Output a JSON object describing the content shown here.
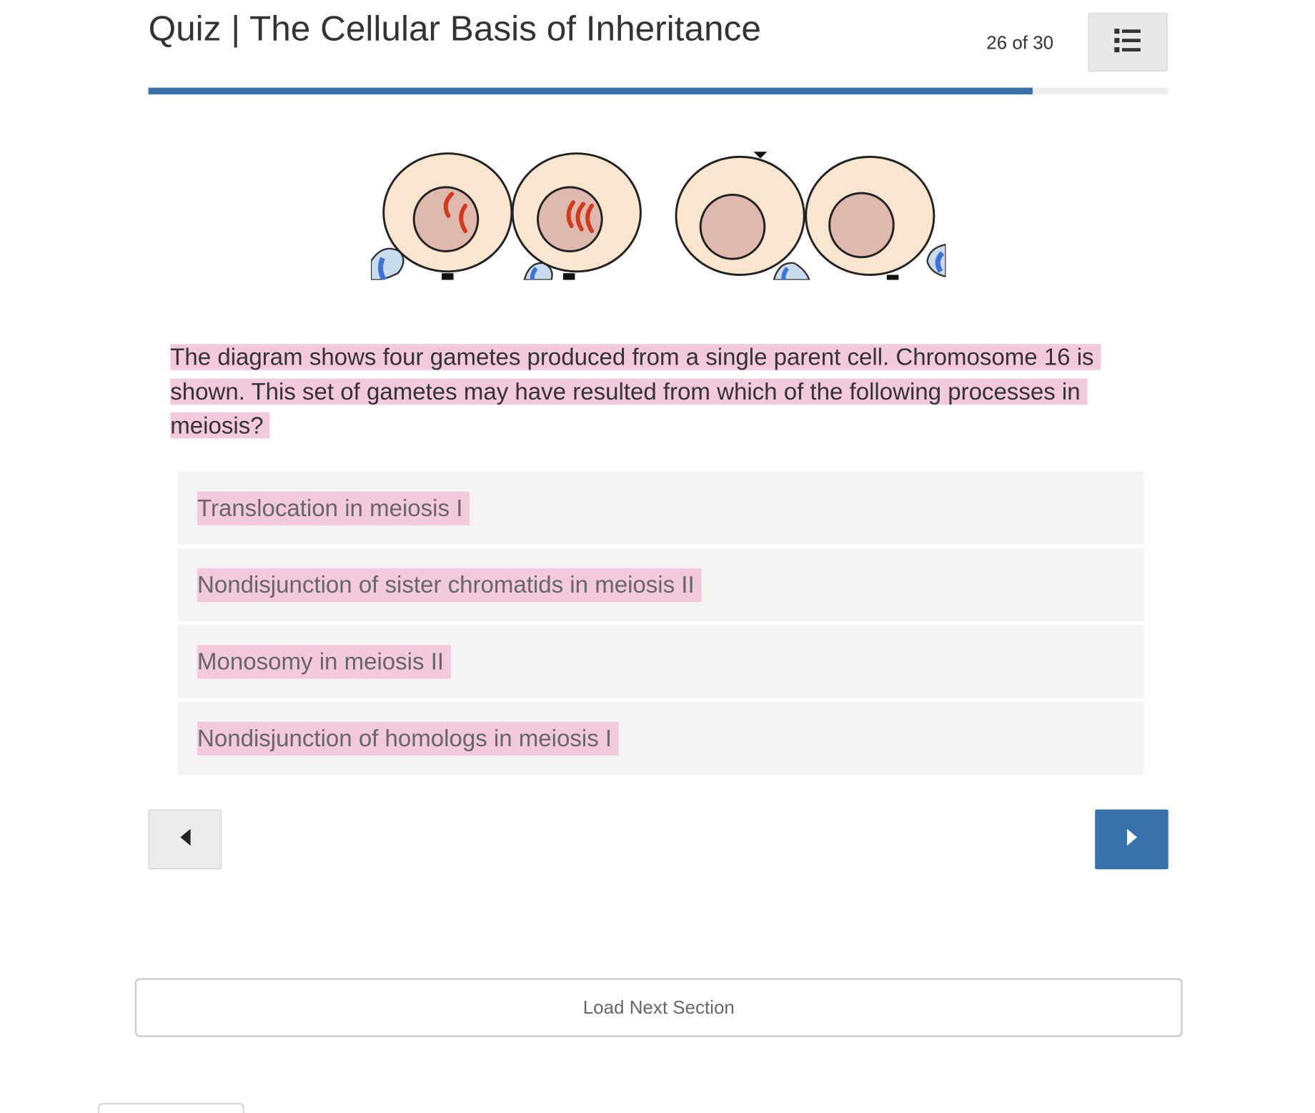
{
  "header": {
    "title": "Quiz | The Cellular Basis of Inheritance",
    "counter": "26 of 30",
    "progress_fraction": 0.8667,
    "menu_icon": "list-icon"
  },
  "colors": {
    "accent": "#3772ad",
    "progress_fill": "#3a6fa8",
    "highlight": "#f3c9dd",
    "answer_bg": "#f4f4f4",
    "cell_cytoplasm": "#fae6cf",
    "cell_nucleus": "#dfb8ae",
    "chromosome": "#d23a1c",
    "blue_shape": "#3b73d6"
  },
  "figure": {
    "description_icon": "gametes-diagram"
  },
  "question": {
    "text": "The diagram shows four gametes produced from a single parent cell. Chromosome 16 is shown. This set of gametes may have resulted from which of the following processes in meiosis?"
  },
  "answers": [
    {
      "label": "Translocation in meiosis I"
    },
    {
      "label": "Nondisjunction of sister chromatids in meiosis II"
    },
    {
      "label": "Monosomy in meiosis II"
    },
    {
      "label": "Nondisjunction of homologs in meiosis I"
    }
  ],
  "navigation": {
    "prev_icon": "caret-left-icon",
    "next_icon": "caret-right-icon"
  },
  "footer": {
    "load_next_label": "Load Next Section"
  }
}
